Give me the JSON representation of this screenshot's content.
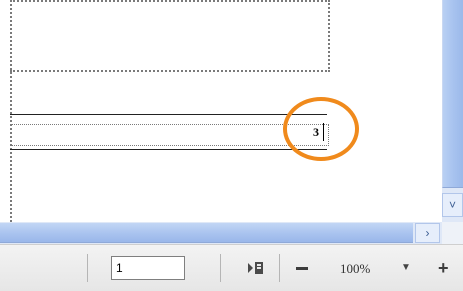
{
  "document": {
    "field_value": "3"
  },
  "statusbar": {
    "page_number": "1",
    "zoom_level": "100%",
    "zoom_dropdown_glyph": "▼",
    "zoom_in_glyph": "+",
    "icons": [
      "page-navigation-icon",
      "zoom-out-icon",
      "zoom-dropdown-icon",
      "zoom-in-icon"
    ]
  },
  "scrollbars": {
    "down_glyph": "˅",
    "right_glyph": "›"
  },
  "colors": {
    "highlight": "#f08a1c",
    "scrollbar": "#a9c3ef"
  }
}
